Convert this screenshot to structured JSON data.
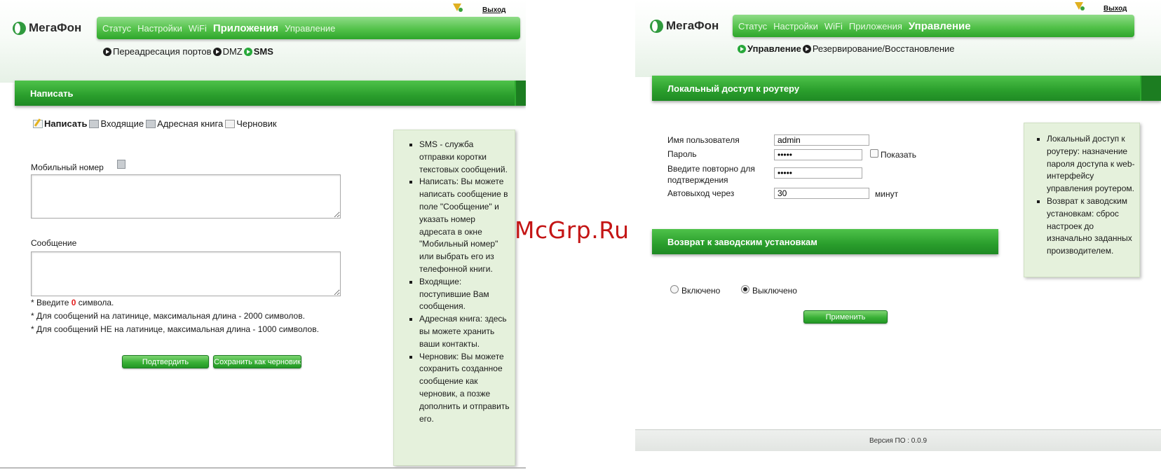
{
  "left": {
    "logo_text": "МегаФон",
    "exit_label": "Выход",
    "nav": [
      "Статус",
      "Настройки",
      "WiFi",
      "Приложения",
      "Управление"
    ],
    "nav_active": "Приложения",
    "subnav": [
      "Переадресация портов",
      "DMZ",
      "SMS"
    ],
    "section_title": "Написать",
    "tabs": [
      "Написать",
      "Входящие",
      "Адресная книга",
      "Черновик"
    ],
    "mobile_label": "Мобильный номер",
    "message_label": "Сообщение",
    "note1_pre": "* Введите ",
    "note1_count": "0",
    "note1_post": " символа.",
    "note2": "* Для сообщений на латинице, максимальная длина - 2000 символов.",
    "note3": "* Для сообщений НЕ на латинице, максимальная длина - 1000 символов.",
    "confirm_button": "Подтвердить",
    "draft_button": "Сохранить как черновик",
    "help": [
      "SMS - служба отправки коротки текстовых сообщений.",
      "Написать: Вы можете написать сообщение в поле \"Сообщение\" и указать номер адресата в окне \"Мобильный номер\" или выбрать его из телефонной книги.",
      "Входящие: поступившие Вам сообщения.",
      "Адресная книга: здесь вы можете хранить ваши контакты.",
      "Черновик: Вы можете сохранить созданное сообщение как черновик, а позже дополнить и отправить его."
    ]
  },
  "right": {
    "logo_text": "МегаФон",
    "exit_label": "Выход",
    "nav": [
      "Статус",
      "Настройки",
      "WiFi",
      "Приложения",
      "Управление"
    ],
    "nav_active": "Управление",
    "subnav": [
      "Управление",
      "Резервирование/Восстановление"
    ],
    "section1_title": "Локальный доступ к роутеру",
    "username_label": "Имя пользователя",
    "username_value": "admin",
    "password_label": "Пароль",
    "password_value": "•••••",
    "show_label": "Показать",
    "confirm_label": "Введите повторно для подтверждения",
    "confirm_value": "•••••",
    "autologout_label": "Автовыход через",
    "autologout_value": "30",
    "autologout_unit": "минут",
    "section2_title": "Возврат к заводским установкам",
    "radio_on": "Включено",
    "radio_off": "Выключено",
    "apply_button": "Применить",
    "help": [
      "Локальный доступ к роутеру: назначение пароля доступа к web-интерфейсу управления роутером.",
      "Возврат к заводским установкам: сброс настроек до изначально заданных производителем."
    ],
    "firmware": "Версия ПО : 0.0.9"
  },
  "watermark": "McGrp.Ru",
  "colors": {
    "brand_green": "#2ea52b",
    "help_bg": "#e5f1dc",
    "alert_red": "#e31e1e",
    "watermark": "#c41515"
  }
}
